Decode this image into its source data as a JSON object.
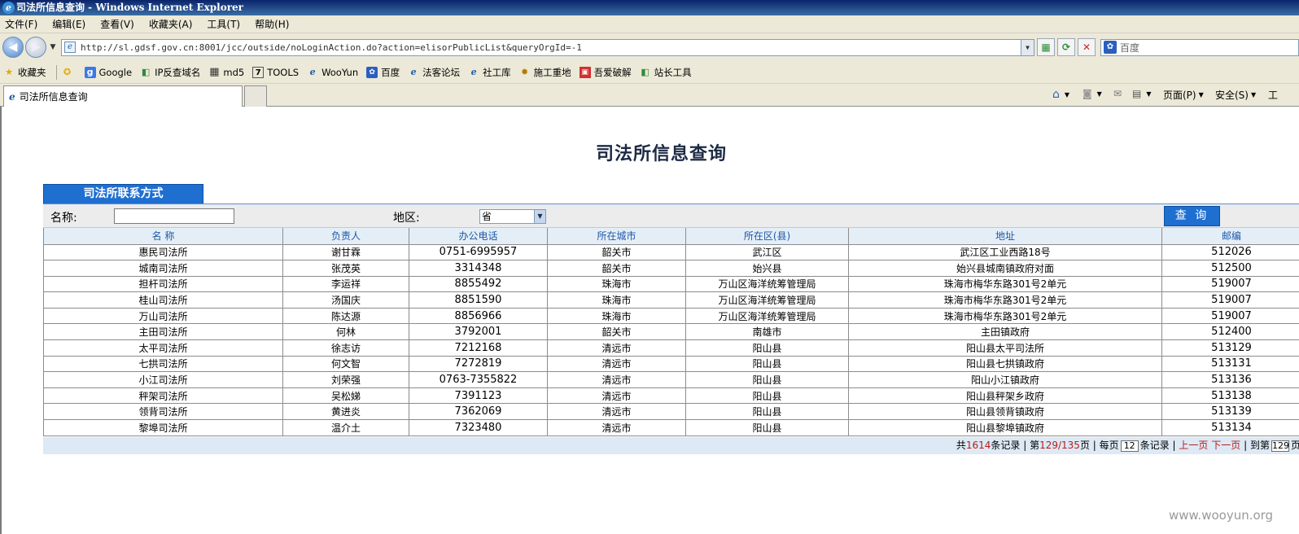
{
  "window": {
    "title": "司法所信息查询 - Windows Internet Explorer"
  },
  "menu": [
    "文件(F)",
    "编辑(E)",
    "查看(V)",
    "收藏夹(A)",
    "工具(T)",
    "帮助(H)"
  ],
  "address": {
    "url": "http://sl.gdsf.gov.cn:8001/jcc/outside/noLoginAction.do?action=elisorPublicList&queryOrgId=-1",
    "search_text": "百度"
  },
  "favorites": {
    "label": "收藏夹",
    "items": [
      "Google",
      "IP反查域名",
      "md5",
      "TOOLS",
      "WooYun",
      "百度",
      "法客论坛",
      "社工库",
      "施工重地",
      "吾爱破解",
      "站长工具"
    ]
  },
  "tab": {
    "title": "司法所信息查询"
  },
  "commandbar": {
    "page": "页面(P)",
    "safety": "安全(S)",
    "tools": "工"
  },
  "page": {
    "title": "司法所信息查询",
    "section_tab": "司法所联系方式",
    "filter": {
      "name_label": "名称:",
      "name_value": "",
      "region_label": "地区:",
      "region_value": "省",
      "query_button": "查 询"
    }
  },
  "table": {
    "headers": [
      "名 称",
      "负责人",
      "办公电话",
      "所在城市",
      "所在区(县)",
      "地址",
      "邮编"
    ],
    "rows": [
      [
        "惠民司法所",
        "谢甘霖",
        "0751-6995957",
        "韶关市",
        "武江区",
        "武江区工业西路18号",
        "512026"
      ],
      [
        "城南司法所",
        "张茂英",
        "3314348",
        "韶关市",
        "始兴县",
        "始兴县城南镇政府对面",
        "512500"
      ],
      [
        "担杆司法所",
        "李运祥",
        "8855492",
        "珠海市",
        "万山区海洋统筹管理局",
        "珠海市梅华东路301号2单元",
        "519007"
      ],
      [
        "桂山司法所",
        "汤国庆",
        "8851590",
        "珠海市",
        "万山区海洋统筹管理局",
        "珠海市梅华东路301号2单元",
        "519007"
      ],
      [
        "万山司法所",
        "陈达源",
        "8856966",
        "珠海市",
        "万山区海洋统筹管理局",
        "珠海市梅华东路301号2单元",
        "519007"
      ],
      [
        "主田司法所",
        "何林",
        "3792001",
        "韶关市",
        "南雄市",
        "主田镇政府",
        "512400"
      ],
      [
        "太平司法所",
        "徐志访",
        "7212168",
        "清远市",
        "阳山县",
        "阳山县太平司法所",
        "513129"
      ],
      [
        "七拱司法所",
        "何文智",
        "7272819",
        "清远市",
        "阳山县",
        "阳山县七拱镇政府",
        "513131"
      ],
      [
        "小江司法所",
        "刘荣强",
        "0763-7355822",
        "清远市",
        "阳山县",
        "阳山小江镇政府",
        "513136"
      ],
      [
        "秤架司法所",
        "吴松娣",
        "7391123",
        "清远市",
        "阳山县",
        "阳山县秤架乡政府",
        "513138"
      ],
      [
        "领背司法所",
        "黄进炎",
        "7362069",
        "清远市",
        "阳山县",
        "阳山县领背镇政府",
        "513139"
      ],
      [
        "黎埠司法所",
        "温介土",
        "7323480",
        "清远市",
        "阳山县",
        "阳山县黎埠镇政府",
        "513134"
      ]
    ]
  },
  "pager": {
    "total_prefix": "共",
    "total": "1614",
    "total_suffix": "条记录",
    "page_prefix": "第",
    "page": "129/135",
    "page_suffix": "页",
    "per_prefix": "每页",
    "per_page": "12",
    "per_suffix": "条记录",
    "prev": "上一页",
    "next": "下一页",
    "goto_prefix": "到第",
    "goto_page": "129",
    "goto_suffix": "页"
  },
  "watermark": "www.wooyun.org"
}
